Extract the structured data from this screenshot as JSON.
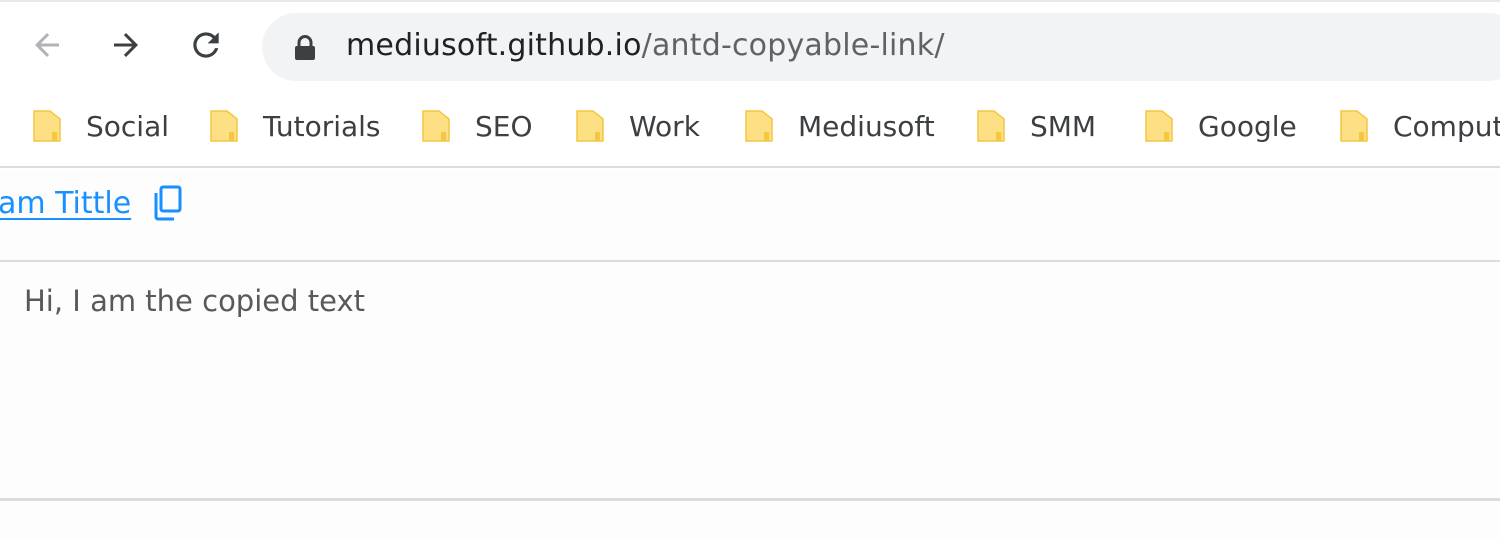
{
  "browser": {
    "url_host": "mediusoft.github.io",
    "url_path": "/antd-copyable-link/",
    "icons": {
      "back": "arrow-left-icon",
      "forward": "arrow-right-icon",
      "reload": "reload-icon",
      "lock": "lock-icon"
    }
  },
  "bookmarks": {
    "items": [
      {
        "label": "Social",
        "icon": "folder-icon"
      },
      {
        "label": "Tutorials",
        "icon": "folder-icon"
      },
      {
        "label": "SEO",
        "icon": "folder-icon"
      },
      {
        "label": "Work",
        "icon": "folder-icon"
      },
      {
        "label": "Mediusoft",
        "icon": "folder-icon"
      },
      {
        "label": "SMM",
        "icon": "folder-icon"
      },
      {
        "label": "Google",
        "icon": "folder-icon"
      },
      {
        "label": "Comput",
        "icon": "folder-icon"
      }
    ]
  },
  "page": {
    "title_link": "am Tittle",
    "copy_icon": "copy-icon",
    "copied_text": "Hi, I am the copied text"
  },
  "colors": {
    "link": "#1890ff",
    "folder_fill": "#fce083",
    "folder_stroke": "#f5c642"
  }
}
